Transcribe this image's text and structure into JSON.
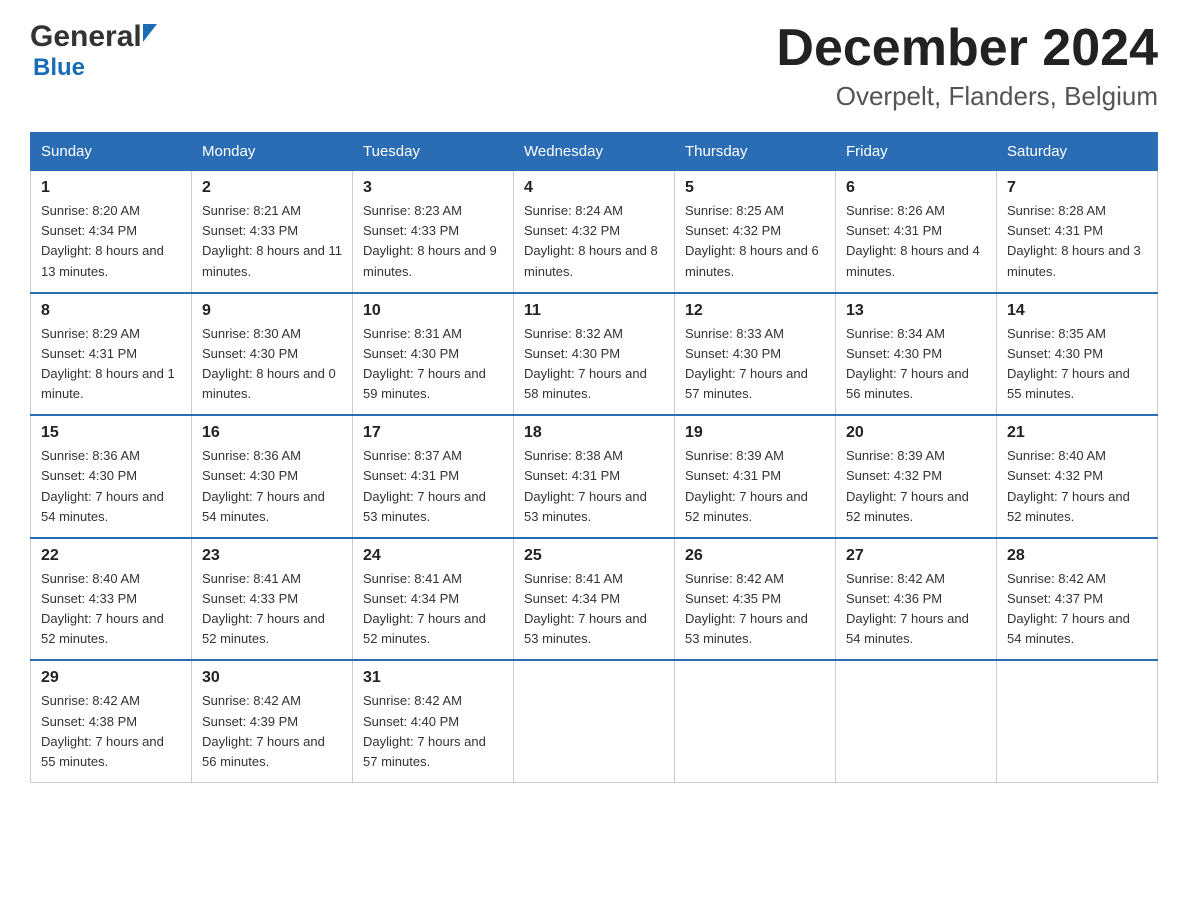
{
  "header": {
    "logo_general": "General",
    "logo_blue": "Blue",
    "month_title": "December 2024",
    "location": "Overpelt, Flanders, Belgium"
  },
  "days_of_week": [
    "Sunday",
    "Monday",
    "Tuesday",
    "Wednesday",
    "Thursday",
    "Friday",
    "Saturday"
  ],
  "weeks": [
    [
      {
        "day": "1",
        "sunrise": "8:20 AM",
        "sunset": "4:34 PM",
        "daylight": "8 hours and 13 minutes."
      },
      {
        "day": "2",
        "sunrise": "8:21 AM",
        "sunset": "4:33 PM",
        "daylight": "8 hours and 11 minutes."
      },
      {
        "day": "3",
        "sunrise": "8:23 AM",
        "sunset": "4:33 PM",
        "daylight": "8 hours and 9 minutes."
      },
      {
        "day": "4",
        "sunrise": "8:24 AM",
        "sunset": "4:32 PM",
        "daylight": "8 hours and 8 minutes."
      },
      {
        "day": "5",
        "sunrise": "8:25 AM",
        "sunset": "4:32 PM",
        "daylight": "8 hours and 6 minutes."
      },
      {
        "day": "6",
        "sunrise": "8:26 AM",
        "sunset": "4:31 PM",
        "daylight": "8 hours and 4 minutes."
      },
      {
        "day": "7",
        "sunrise": "8:28 AM",
        "sunset": "4:31 PM",
        "daylight": "8 hours and 3 minutes."
      }
    ],
    [
      {
        "day": "8",
        "sunrise": "8:29 AM",
        "sunset": "4:31 PM",
        "daylight": "8 hours and 1 minute."
      },
      {
        "day": "9",
        "sunrise": "8:30 AM",
        "sunset": "4:30 PM",
        "daylight": "8 hours and 0 minutes."
      },
      {
        "day": "10",
        "sunrise": "8:31 AM",
        "sunset": "4:30 PM",
        "daylight": "7 hours and 59 minutes."
      },
      {
        "day": "11",
        "sunrise": "8:32 AM",
        "sunset": "4:30 PM",
        "daylight": "7 hours and 58 minutes."
      },
      {
        "day": "12",
        "sunrise": "8:33 AM",
        "sunset": "4:30 PM",
        "daylight": "7 hours and 57 minutes."
      },
      {
        "day": "13",
        "sunrise": "8:34 AM",
        "sunset": "4:30 PM",
        "daylight": "7 hours and 56 minutes."
      },
      {
        "day": "14",
        "sunrise": "8:35 AM",
        "sunset": "4:30 PM",
        "daylight": "7 hours and 55 minutes."
      }
    ],
    [
      {
        "day": "15",
        "sunrise": "8:36 AM",
        "sunset": "4:30 PM",
        "daylight": "7 hours and 54 minutes."
      },
      {
        "day": "16",
        "sunrise": "8:36 AM",
        "sunset": "4:30 PM",
        "daylight": "7 hours and 54 minutes."
      },
      {
        "day": "17",
        "sunrise": "8:37 AM",
        "sunset": "4:31 PM",
        "daylight": "7 hours and 53 minutes."
      },
      {
        "day": "18",
        "sunrise": "8:38 AM",
        "sunset": "4:31 PM",
        "daylight": "7 hours and 53 minutes."
      },
      {
        "day": "19",
        "sunrise": "8:39 AM",
        "sunset": "4:31 PM",
        "daylight": "7 hours and 52 minutes."
      },
      {
        "day": "20",
        "sunrise": "8:39 AM",
        "sunset": "4:32 PM",
        "daylight": "7 hours and 52 minutes."
      },
      {
        "day": "21",
        "sunrise": "8:40 AM",
        "sunset": "4:32 PM",
        "daylight": "7 hours and 52 minutes."
      }
    ],
    [
      {
        "day": "22",
        "sunrise": "8:40 AM",
        "sunset": "4:33 PM",
        "daylight": "7 hours and 52 minutes."
      },
      {
        "day": "23",
        "sunrise": "8:41 AM",
        "sunset": "4:33 PM",
        "daylight": "7 hours and 52 minutes."
      },
      {
        "day": "24",
        "sunrise": "8:41 AM",
        "sunset": "4:34 PM",
        "daylight": "7 hours and 52 minutes."
      },
      {
        "day": "25",
        "sunrise": "8:41 AM",
        "sunset": "4:34 PM",
        "daylight": "7 hours and 53 minutes."
      },
      {
        "day": "26",
        "sunrise": "8:42 AM",
        "sunset": "4:35 PM",
        "daylight": "7 hours and 53 minutes."
      },
      {
        "day": "27",
        "sunrise": "8:42 AM",
        "sunset": "4:36 PM",
        "daylight": "7 hours and 54 minutes."
      },
      {
        "day": "28",
        "sunrise": "8:42 AM",
        "sunset": "4:37 PM",
        "daylight": "7 hours and 54 minutes."
      }
    ],
    [
      {
        "day": "29",
        "sunrise": "8:42 AM",
        "sunset": "4:38 PM",
        "daylight": "7 hours and 55 minutes."
      },
      {
        "day": "30",
        "sunrise": "8:42 AM",
        "sunset": "4:39 PM",
        "daylight": "7 hours and 56 minutes."
      },
      {
        "day": "31",
        "sunrise": "8:42 AM",
        "sunset": "4:40 PM",
        "daylight": "7 hours and 57 minutes."
      },
      null,
      null,
      null,
      null
    ]
  ],
  "labels": {
    "sunrise": "Sunrise:",
    "sunset": "Sunset:",
    "daylight": "Daylight:"
  }
}
